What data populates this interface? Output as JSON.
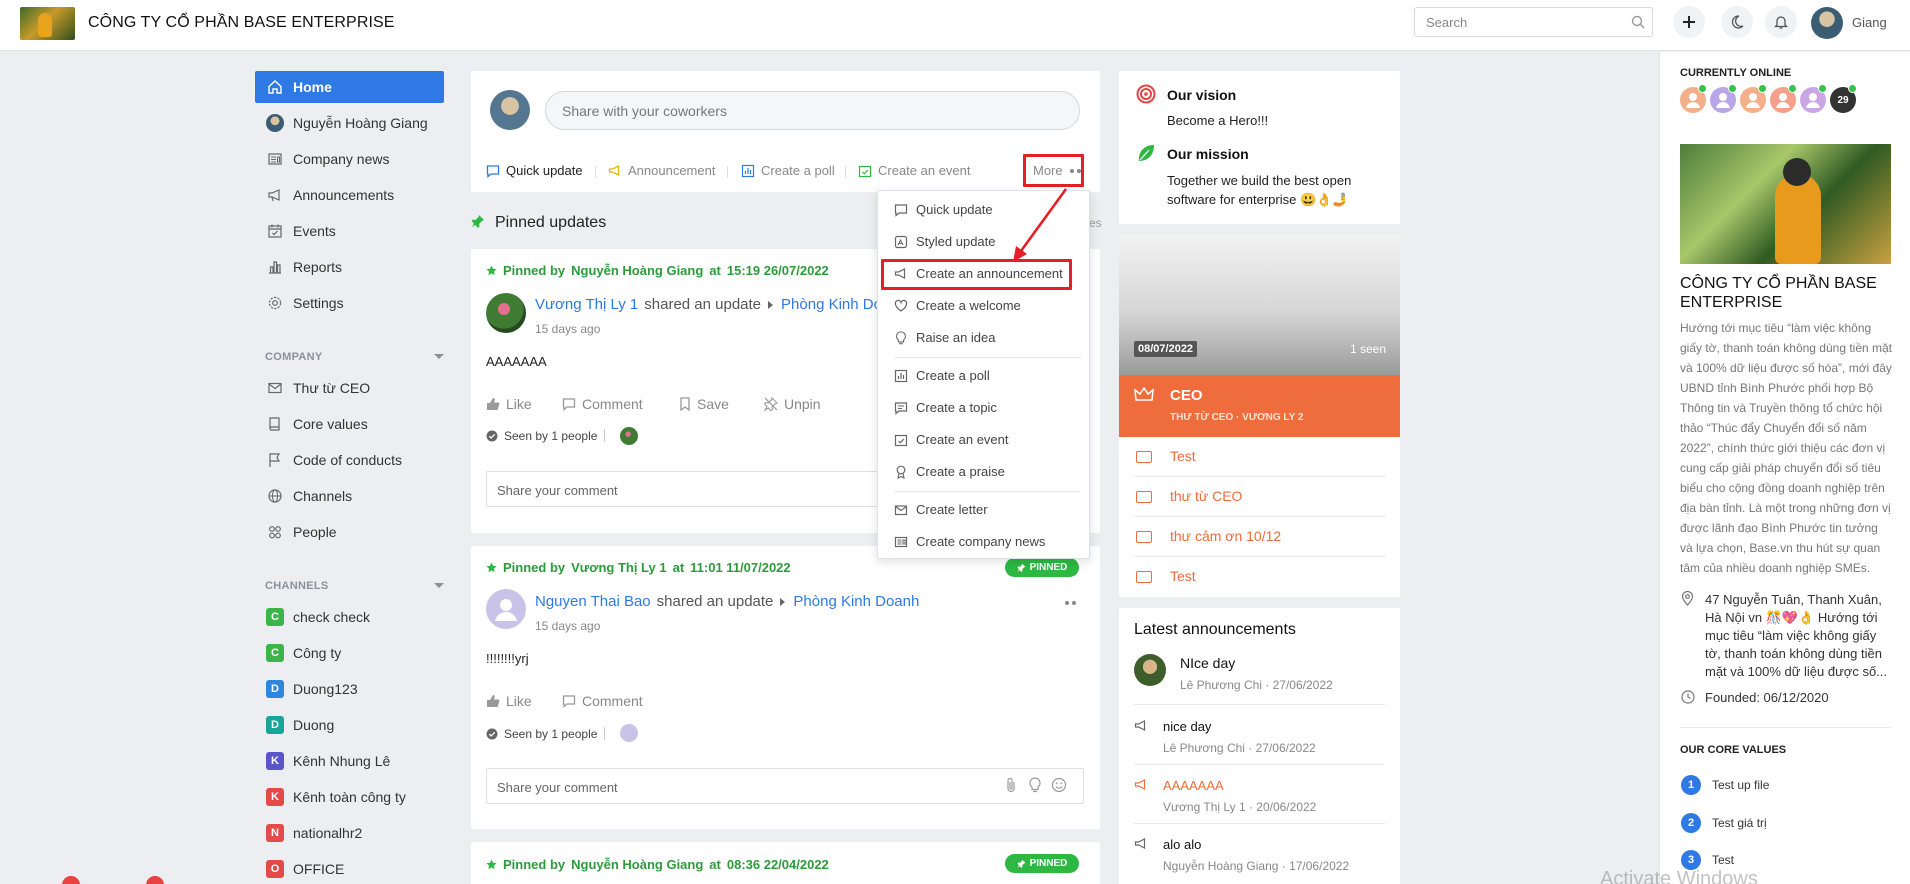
{
  "header": {
    "company_name": "CÔNG TY CỔ PHẦN BASE ENTERPRISE",
    "search_placeholder": "Search",
    "user_name": "Giang"
  },
  "sidebar": {
    "items": [
      {
        "label": "Home",
        "icon": "home-icon"
      },
      {
        "label": "Nguyễn Hoàng Giang",
        "icon": "avatar"
      },
      {
        "label": "Company news",
        "icon": "newspaper-icon"
      },
      {
        "label": "Announcements",
        "icon": "megaphone-icon"
      },
      {
        "label": "Events",
        "icon": "calendar-icon"
      },
      {
        "label": "Reports",
        "icon": "bar-chart-icon"
      },
      {
        "label": "Settings",
        "icon": "gear-icon"
      }
    ],
    "company_header": "COMPANY",
    "company_items": [
      {
        "label": "Thư từ CEO",
        "icon": "mail-icon"
      },
      {
        "label": "Core values",
        "icon": "book-icon"
      },
      {
        "label": "Code of conducts",
        "icon": "flag-icon"
      },
      {
        "label": "Channels",
        "icon": "globe-icon"
      },
      {
        "label": "People",
        "icon": "people-icon"
      }
    ],
    "channels_header": "CHANNELS",
    "channels": [
      {
        "letter": "C",
        "label": "check check",
        "color": "#3bb54a"
      },
      {
        "letter": "C",
        "label": "Công ty",
        "color": "#3bb54a"
      },
      {
        "letter": "D",
        "label": "Duong123",
        "color": "#2e86de"
      },
      {
        "letter": "D",
        "label": "Duong",
        "color": "#18a599"
      },
      {
        "letter": "K",
        "label": "Kênh Nhung Lê",
        "color": "#5a55c8"
      },
      {
        "letter": "K",
        "label": "Kênh toàn công ty",
        "color": "#e34b4b"
      },
      {
        "letter": "N",
        "label": "nationalhr2",
        "color": "#e34b4b"
      },
      {
        "letter": "O",
        "label": "OFFICE",
        "color": "#e34b4b"
      }
    ]
  },
  "composer": {
    "placeholder": "Share with your coworkers",
    "tabs": [
      "Quick update",
      "Announcement",
      "Create a poll",
      "Create an event"
    ],
    "more_label": "More"
  },
  "pinned": {
    "title": "Pinned updates",
    "cut_label": "es"
  },
  "posts": [
    {
      "pinned_prefix": "Pinned by",
      "pinned_by": "Nguyễn Hoàng Giang",
      "at_word": "at",
      "pinned_time": "15:19 26/07/2022",
      "author": "Vương Thị Ly 1",
      "verb": "shared an update",
      "group": "Phòng Kinh Doa",
      "time": "15 days ago",
      "text": "AAAAAAA",
      "actions": [
        "Like",
        "Comment",
        "Save",
        "Unpin"
      ],
      "seen": "Seen by 1 people",
      "comment_placeholder": "Share your comment"
    },
    {
      "pinned_prefix": "Pinned by",
      "pinned_by": "Vương Thị Ly 1",
      "at_word": "at",
      "pinned_time": "11:01 11/07/2022",
      "badge": "PINNED",
      "author": "Nguyen Thai Bao",
      "verb": "shared an update",
      "group": "Phòng Kinh Doanh",
      "time": "15 days ago",
      "text": "!!!!!!!!yrj",
      "actions": [
        "Like",
        "Comment"
      ],
      "seen": "Seen by 1 people",
      "comment_placeholder": "Share your comment"
    },
    {
      "pinned_prefix": "Pinned by",
      "pinned_by": "Nguyễn Hoàng Giang",
      "at_word": "at",
      "pinned_time": "08:36 22/04/2022",
      "badge": "PINNED"
    }
  ],
  "dropdown": {
    "items": [
      "Quick update",
      "Styled update",
      "Create an announcement",
      "Create a welcome",
      "Raise an idea",
      "Create a poll",
      "Create a topic",
      "Create an event",
      "Create a praise",
      "Create letter",
      "Create company news"
    ]
  },
  "vision": {
    "title": "Our vision",
    "text": "Become a Hero!!!",
    "mission_title": "Our mission",
    "mission_text": "Together we build the best open software for enterprise 😃👌🤳"
  },
  "ceo_card": {
    "date": "08/07/2022",
    "seen": "1 seen",
    "title": "CEO",
    "subtitle": "THƯ TỪ CEO · VƯƠNG LY 2",
    "links": [
      "Test",
      "thư từ CEO",
      "thư cảm ơn 10/12",
      "Test"
    ]
  },
  "latest": {
    "title": "Latest announcements",
    "items": [
      {
        "title": "NIce day",
        "meta": "Lê Phương Chi · 27/06/2022"
      },
      {
        "title": "nice day",
        "meta": "Lê Phương Chi · 27/06/2022"
      },
      {
        "title": "AAAAAAA",
        "meta": "Vương Thị Ly 1 · 20/06/2022"
      },
      {
        "title": "alo alo",
        "meta": "Nguyễn Hoàng Giang · 17/06/2022"
      }
    ]
  },
  "online": {
    "title": "CURRENTLY ONLINE",
    "count": "29"
  },
  "company_info": {
    "name": "CÔNG TY CỔ PHẦN BASE ENTERPRISE",
    "description": "Hướng tới mục tiêu “làm việc không giấy tờ, thanh toán không dùng tiền mặt và 100% dữ liệu được số hóa”, mới đây UBND tỉnh Bình Phước phối hợp Bộ Thông tin và Truyền thông tổ chức hội thảo “Thúc đẩy Chuyển đổi số năm 2022”, chính thức giới thiệu các đơn vị cung cấp giải pháp chuyển đổi số tiêu biểu cho cộng đồng doanh nghiệp trên địa bàn tỉnh. Là một trong những đơn vị được lãnh đạo Bình Phước tin tưởng và lựa chọn, Base.vn thu hút sự quan tâm của nhiều doanh nghiệp SMEs. Theo...",
    "address": "47 Nguyễn Tuân, Thanh Xuân, Hà Nội vn 🎊💖👌 Hướng tới mục tiêu “làm việc không giấy tờ, thanh toán không dùng tiền mặt và 100% dữ liệu được số...",
    "founded": "Founded: 06/12/2020",
    "core_values_title": "OUR CORE VALUES",
    "core_values": [
      "Test up file",
      "Test giá trị",
      "Test"
    ]
  },
  "watermark": "Activate Windows"
}
